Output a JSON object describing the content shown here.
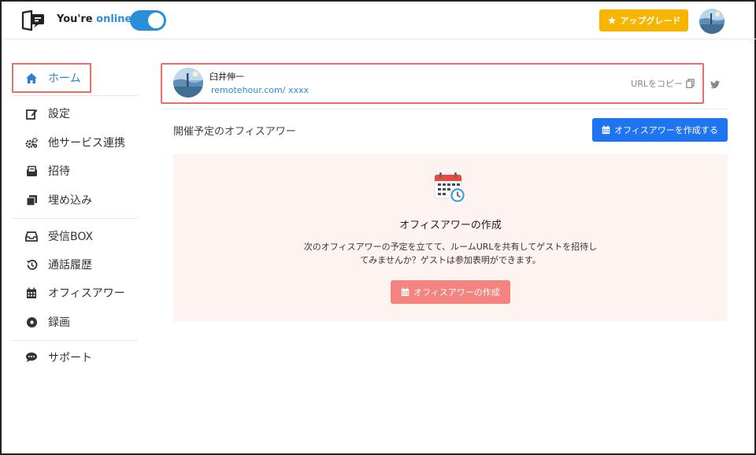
{
  "header": {
    "status_prefix": "You're ",
    "status_online": "online",
    "upgrade_label": "アップグレード",
    "toggle_on": true
  },
  "sidebar": {
    "items": [
      {
        "label": "ホーム",
        "icon": "home-icon"
      },
      {
        "label": "設定",
        "icon": "edit-icon"
      },
      {
        "label": "他サービス連携",
        "icon": "gears-icon"
      },
      {
        "label": "招待",
        "icon": "invite-icon"
      },
      {
        "label": "埋め込み",
        "icon": "embed-icon"
      },
      {
        "label": "受信BOX",
        "icon": "inbox-icon"
      },
      {
        "label": "通話履歴",
        "icon": "history-icon"
      },
      {
        "label": "オフィスアワー",
        "icon": "calendar-icon"
      },
      {
        "label": "録画",
        "icon": "record-icon"
      },
      {
        "label": "サポート",
        "icon": "chat-icon"
      }
    ]
  },
  "profile": {
    "name": "臼井伸一",
    "url": "remotehour.com/ xxxx",
    "copy_label": "URLをコピー"
  },
  "main": {
    "section_title": "開催予定のオフィスアワー",
    "create_button": "オフィスアワーを作成する",
    "empty_title": "オフィスアワーの作成",
    "empty_desc": "次のオフィスアワーの予定を立てて、ルームURLを共有してゲストを招待してみませんか？ゲストは参加表明ができます。",
    "panel_button": "オフィスアワーの作成"
  },
  "colors": {
    "accent": "#2b8ed8",
    "primary_button": "#1f75f0",
    "upgrade": "#f7b500",
    "panel_bg": "#fdf3f1",
    "panel_button": "#f4847f",
    "highlight_border": "#e8706c"
  }
}
